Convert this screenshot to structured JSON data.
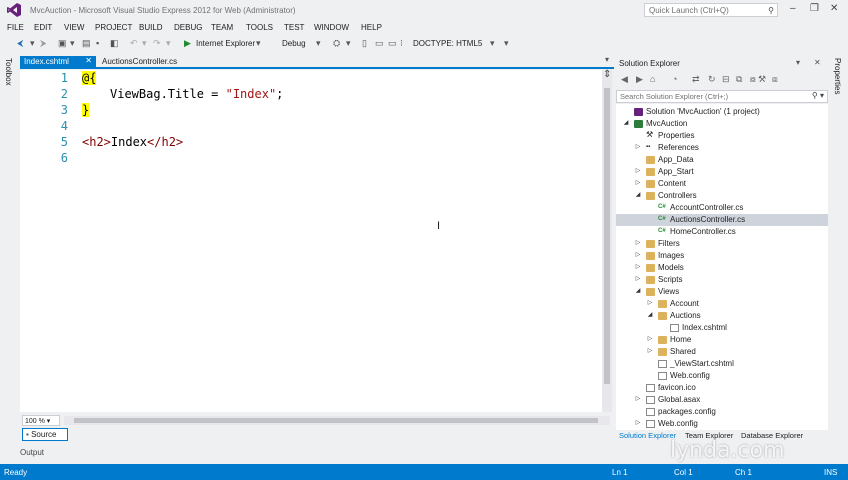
{
  "window": {
    "title": "MvcAuction - Microsoft Visual Studio Express 2012 for Web (Administrator)",
    "quick_launch_placeholder": "Quick Launch (Ctrl+Q)"
  },
  "menu": [
    "FILE",
    "EDIT",
    "VIEW",
    "PROJECT",
    "BUILD",
    "DEBUG",
    "TEAM",
    "TOOLS",
    "TEST",
    "WINDOW",
    "HELP"
  ],
  "toolbar": {
    "browser": "Internet Explorer",
    "config": "Debug",
    "doctype": "DOCTYPE: HTML5"
  },
  "side_tabs": {
    "toolbox": "Toolbox",
    "properties": "Properties"
  },
  "editor": {
    "tabs": [
      "Index.cshtml",
      "AuctionsController.cs"
    ],
    "line_numbers": [
      "1",
      "2",
      "3",
      "4",
      "5",
      "6"
    ],
    "code": {
      "l1": "@{",
      "l2_prop": "ViewBag.Title = ",
      "l2_str": "\"Index\"",
      "l2_end": ";",
      "l3": "}",
      "l5_open": "<h2>",
      "l5_text": "Index",
      "l5_close": "</h2>"
    },
    "zoom": "100 %",
    "source_tab": "Source",
    "output_tab": "Output"
  },
  "solution_explorer": {
    "title": "Solution Explorer",
    "search_placeholder": "Search Solution Explorer (Ctrl+;)",
    "tree": [
      {
        "label": "Solution 'MvcAuction' (1 project)",
        "level": 0,
        "arrow": "",
        "icon": "solution-icon"
      },
      {
        "label": "MvcAuction",
        "level": 0,
        "arrow": "open",
        "icon": "project-icon"
      },
      {
        "label": "Properties",
        "level": 1,
        "arrow": "",
        "icon": "wrench-icon"
      },
      {
        "label": "References",
        "level": 1,
        "arrow": "closed",
        "icon": "references-icon"
      },
      {
        "label": "App_Data",
        "level": 1,
        "arrow": "",
        "icon": "folder-icon"
      },
      {
        "label": "App_Start",
        "level": 1,
        "arrow": "closed",
        "icon": "folder-icon"
      },
      {
        "label": "Content",
        "level": 1,
        "arrow": "closed",
        "icon": "folder-icon"
      },
      {
        "label": "Controllers",
        "level": 1,
        "arrow": "open",
        "icon": "folder-icon"
      },
      {
        "label": "AccountController.cs",
        "level": 2,
        "arrow": "",
        "icon": "csharp-file-icon"
      },
      {
        "label": "AuctionsController.cs",
        "level": 2,
        "arrow": "",
        "icon": "csharp-file-icon"
      },
      {
        "label": "HomeController.cs",
        "level": 2,
        "arrow": "",
        "icon": "csharp-file-icon"
      },
      {
        "label": "Filters",
        "level": 1,
        "arrow": "closed",
        "icon": "folder-icon"
      },
      {
        "label": "Images",
        "level": 1,
        "arrow": "closed",
        "icon": "folder-icon"
      },
      {
        "label": "Models",
        "level": 1,
        "arrow": "closed",
        "icon": "folder-icon"
      },
      {
        "label": "Scripts",
        "level": 1,
        "arrow": "closed",
        "icon": "folder-icon"
      },
      {
        "label": "Views",
        "level": 1,
        "arrow": "open",
        "icon": "folder-icon"
      },
      {
        "label": "Account",
        "level": 2,
        "arrow": "closed",
        "icon": "folder-icon"
      },
      {
        "label": "Auctions",
        "level": 2,
        "arrow": "open",
        "icon": "folder-icon"
      },
      {
        "label": "Index.cshtml",
        "level": 3,
        "arrow": "",
        "icon": "cshtml-file-icon"
      },
      {
        "label": "Home",
        "level": 2,
        "arrow": "closed",
        "icon": "folder-icon"
      },
      {
        "label": "Shared",
        "level": 2,
        "arrow": "closed",
        "icon": "folder-icon"
      },
      {
        "label": "_ViewStart.cshtml",
        "level": 2,
        "arrow": "",
        "icon": "cshtml-file-icon"
      },
      {
        "label": "Web.config",
        "level": 2,
        "arrow": "",
        "icon": "config-file-icon"
      },
      {
        "label": "favicon.ico",
        "level": 1,
        "arrow": "",
        "icon": "file-icon"
      },
      {
        "label": "Global.asax",
        "level": 1,
        "arrow": "closed",
        "icon": "file-icon"
      },
      {
        "label": "packages.config",
        "level": 1,
        "arrow": "",
        "icon": "config-file-icon"
      },
      {
        "label": "Web.config",
        "level": 1,
        "arrow": "closed",
        "icon": "config-file-icon"
      }
    ],
    "selected_label": "AuctionsController.cs",
    "bottom_tabs": [
      "Solution Explorer",
      "Team Explorer",
      "Database Explorer"
    ]
  },
  "status": {
    "state": "Ready",
    "line": "Ln 1",
    "col": "Col 1",
    "ch": "Ch 1",
    "mode": "INS"
  },
  "watermark": "lynda.com",
  "colors": {
    "accent": "#007acc",
    "selection": "#cfd3dc"
  }
}
